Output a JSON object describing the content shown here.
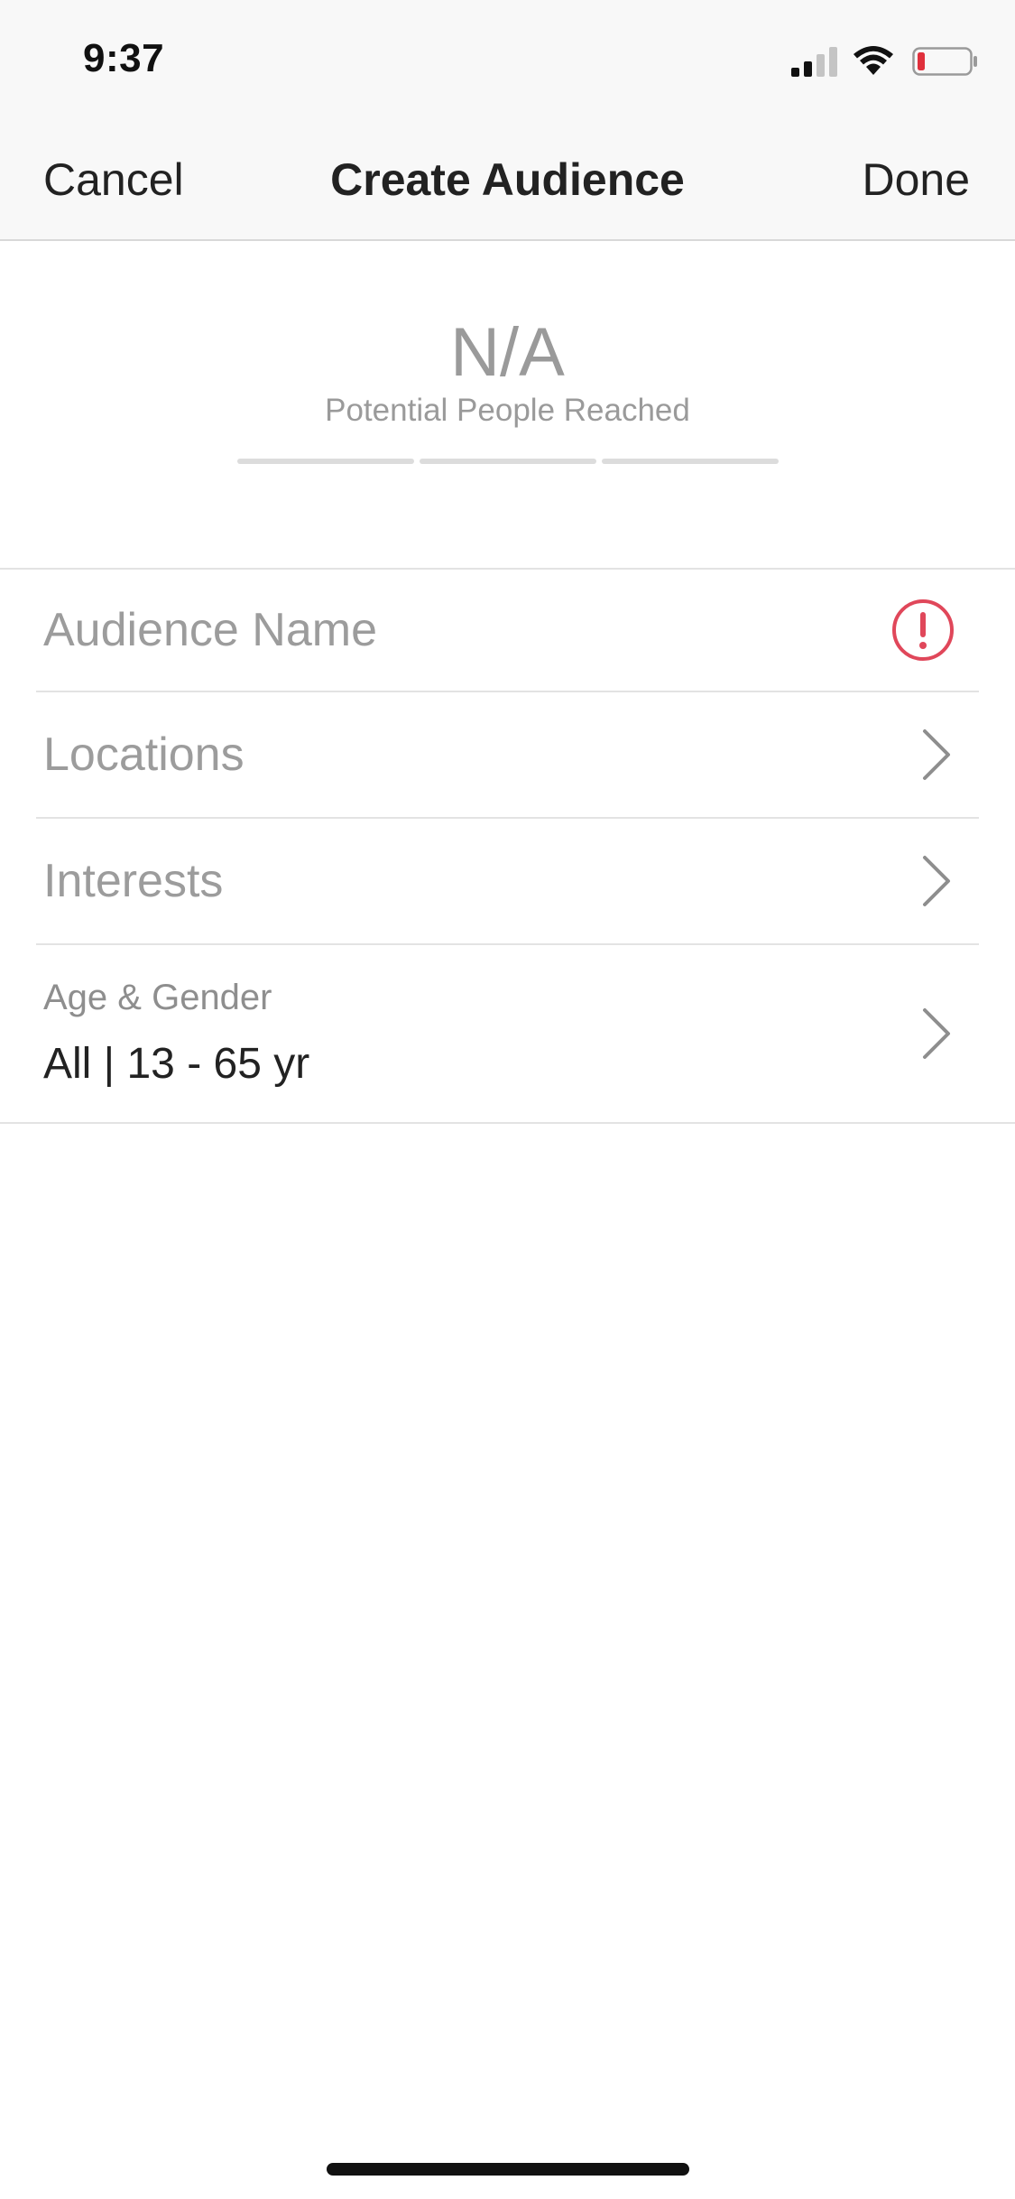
{
  "status_bar": {
    "time": "9:37",
    "icons": [
      "cellular-signal-icon",
      "wifi-icon",
      "battery-low-icon"
    ],
    "battery_color": "#e0303c"
  },
  "nav": {
    "cancel_label": "Cancel",
    "title": "Create Audience",
    "done_label": "Done"
  },
  "reach": {
    "value": "N/A",
    "label": "Potential People Reached",
    "segments": 3
  },
  "form": {
    "audience_name": {
      "placeholder": "Audience Name",
      "icon": "alert-circle-icon",
      "icon_color": "#e0475a"
    },
    "locations": {
      "label": "Locations",
      "icon": "chevron-right-icon"
    },
    "interests": {
      "label": "Interests",
      "icon": "chevron-right-icon"
    },
    "age_gender": {
      "label": "Age & Gender",
      "value": "All | 13 - 65 yr",
      "icon": "chevron-right-icon"
    }
  },
  "colors": {
    "nav_background": "#f8f8f8",
    "text_primary": "#222222",
    "text_placeholder": "#9c9c9c",
    "divider": "#e3e3e3",
    "alert": "#e0475a"
  }
}
